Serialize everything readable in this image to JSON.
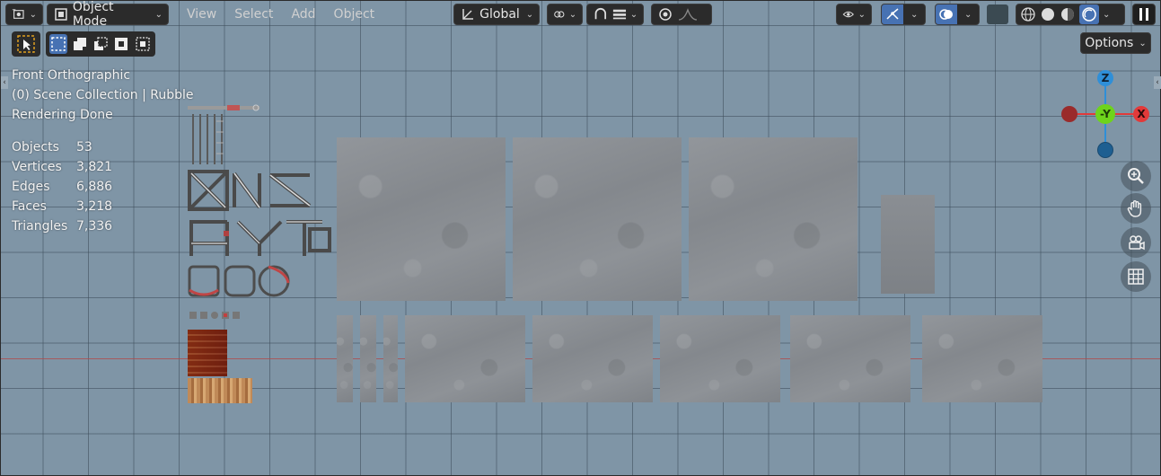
{
  "header": {
    "mode_label": "Object Mode",
    "menus": [
      "View",
      "Select",
      "Add",
      "Object"
    ],
    "orientation_label": "Global"
  },
  "tools": {
    "options_label": "Options"
  },
  "overlay": {
    "view_name": "Front Orthographic",
    "collection": "(0) Scene Collection | Rubble",
    "status": "Rendering Done",
    "stats": [
      {
        "label": "Objects",
        "value": "53"
      },
      {
        "label": "Vertices",
        "value": "3,821"
      },
      {
        "label": "Edges",
        "value": "6,886"
      },
      {
        "label": "Faces",
        "value": "3,218"
      },
      {
        "label": "Triangles",
        "value": "7,336"
      }
    ]
  },
  "gizmo": {
    "z": "Z",
    "y": "-Y",
    "x": "X"
  },
  "colors": {
    "viewport_bg": "#7f95a6",
    "accent_blue": "#4772b3",
    "axis_x": "#e23a3a",
    "axis_y": "#6ed41c",
    "axis_z": "#2f8fd8"
  },
  "icons": [
    "editor-type-icon",
    "object-mode-icon",
    "transform-pivot-icon",
    "snap-icon",
    "proportional-edit-icon",
    "visibility-icon",
    "gizmo-icon",
    "overlay-icon",
    "wireframe-shading-icon",
    "solid-shading-icon",
    "material-shading-icon",
    "rendered-shading-icon",
    "pause-icon",
    "select-tool-icon",
    "zoom-icon",
    "hand-icon",
    "camera-icon",
    "grid-icon"
  ]
}
